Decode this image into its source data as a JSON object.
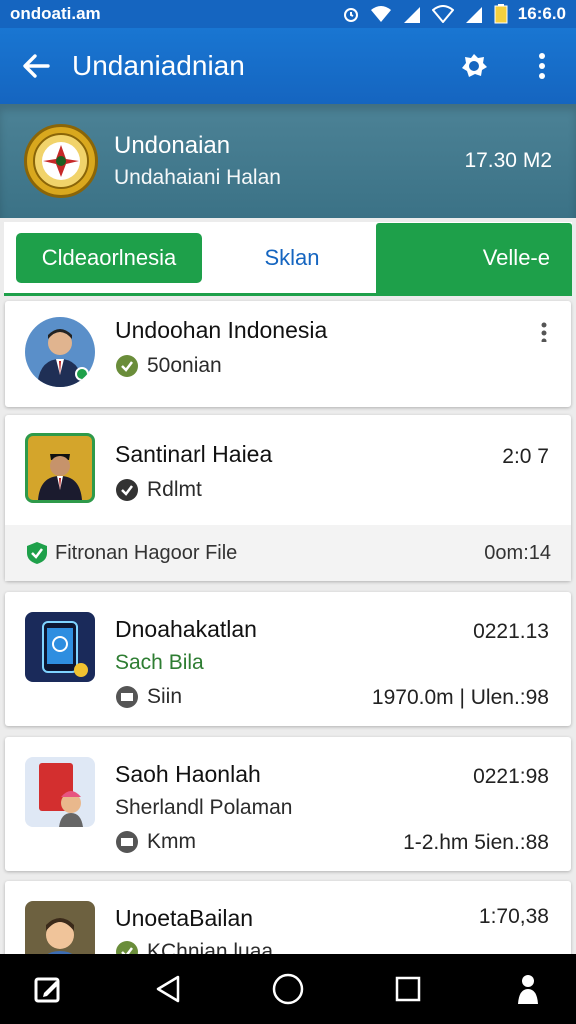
{
  "status_bar": {
    "carrier": "ondoati.am",
    "time": "16:6.0"
  },
  "app_bar": {
    "title": "Undaniadnian"
  },
  "channel": {
    "name": "Undonaian",
    "subtitle": "Undahaiani Halan",
    "size": "17.30 M2"
  },
  "tabs": [
    "Cldeaorlnesia",
    "Sklan",
    "Velle-e"
  ],
  "items": [
    {
      "title": "Undoohan Indonesia",
      "subtitle": "50onian"
    },
    {
      "title": "Santinarl Haiea",
      "subtitle": "Rdlmt",
      "meta": "2:0 7",
      "footer_text": "Fitronan Hagoor File",
      "footer_time": "0om:14"
    },
    {
      "title": "Dnoahakatlan",
      "subtitle": "Sach Bila",
      "third": "Siin",
      "meta": "0221.13",
      "bottom_meta": "1970.0m | Ulen.:98"
    },
    {
      "title": "Saoh Haonlah",
      "subtitle": "Sherlandl Polaman",
      "third": "Kmm",
      "meta": "0221:98",
      "bottom_meta": "1-2.hm  5ien.:88"
    },
    {
      "title": "UnoetaBailan",
      "subtitle": "KChnian luaa",
      "meta": "1:70,38"
    }
  ],
  "icons": {
    "back": "arrow-left-icon",
    "share": "badge-icon",
    "menu": "more-vert-icon",
    "edit": "edit-icon",
    "nav_back": "triangle-back-icon",
    "home": "circle-home-icon",
    "recents": "square-recents-icon",
    "person": "person-icon"
  },
  "colors": {
    "primary": "#1565c0",
    "green": "#1ea04a",
    "header": "#437a8e"
  }
}
